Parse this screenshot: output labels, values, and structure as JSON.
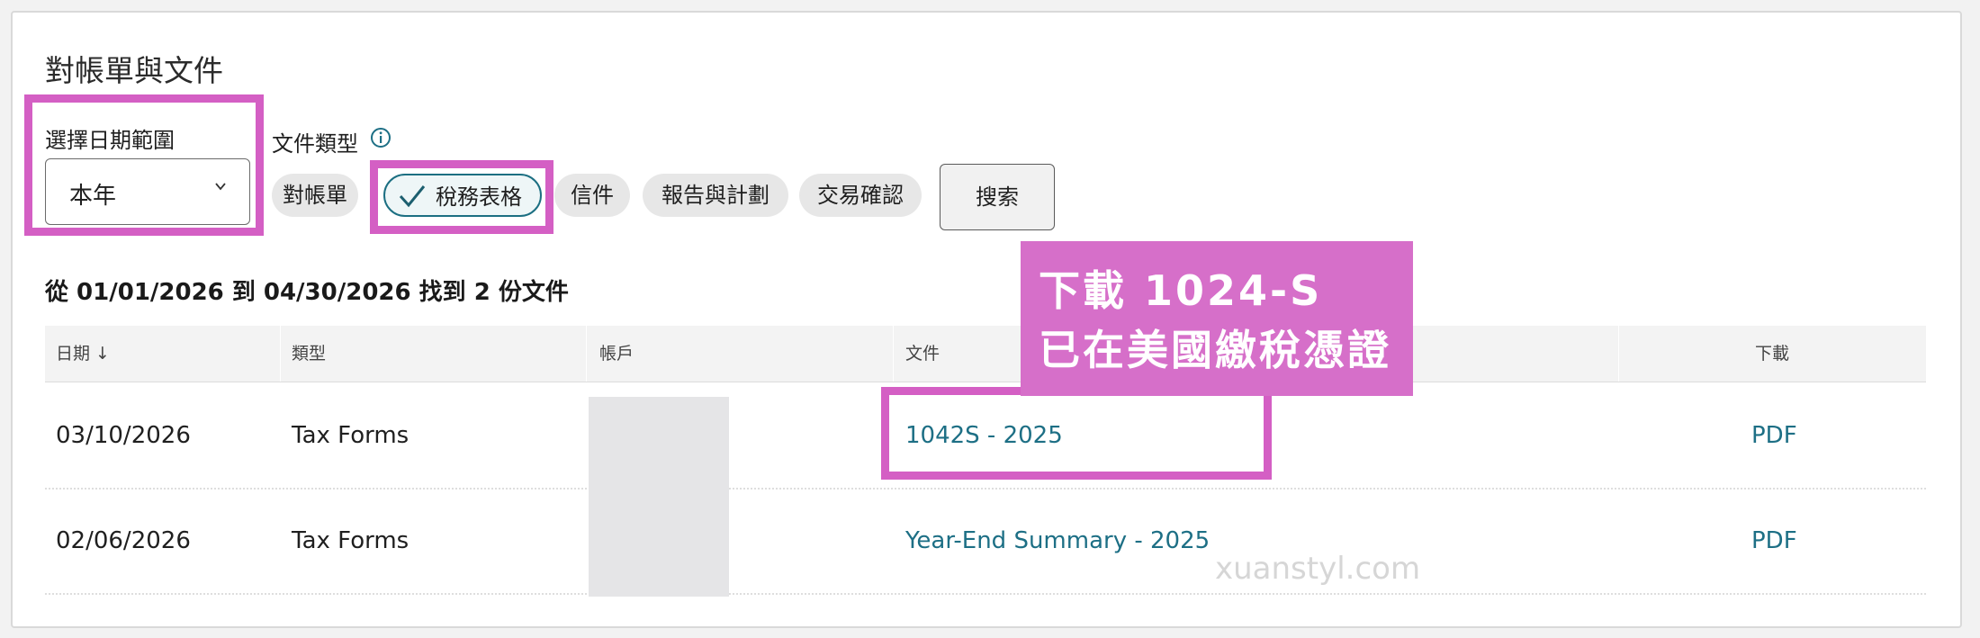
{
  "page": {
    "title": "對帳單與文件"
  },
  "filters": {
    "date_range_label": "選擇日期範圍",
    "date_range_value": "本年",
    "doc_type_label": "文件類型",
    "chips": [
      {
        "label": "對帳單",
        "selected": false
      },
      {
        "label": "稅務表格",
        "selected": true
      },
      {
        "label": "信件",
        "selected": false
      },
      {
        "label": "報告與計劃",
        "selected": false
      },
      {
        "label": "交易確認",
        "selected": false
      }
    ],
    "search_label": "搜索"
  },
  "results": {
    "summary": "從 01/01/2026 到 04/30/2026 找到 2 份文件"
  },
  "table": {
    "headers": {
      "date": "日期 ↓",
      "type": "類型",
      "account": "帳戶",
      "document": "文件",
      "download": "下載"
    },
    "rows": [
      {
        "date": "03/10/2026",
        "type": "Tax Forms",
        "account": "",
        "document": "1042S - 2025",
        "download": "PDF"
      },
      {
        "date": "02/06/2026",
        "type": "Tax Forms",
        "account": "",
        "document": "Year-End Summary - 2025",
        "download": "PDF"
      }
    ]
  },
  "annotation": {
    "line1": "下載 1024-S",
    "line2": "已在美國繳稅憑證"
  },
  "watermark": "xuanstyl.com",
  "colors": {
    "accent": "#1d6f85",
    "highlight": "#d45fc4",
    "annotation_bg": "#d66fc9"
  }
}
